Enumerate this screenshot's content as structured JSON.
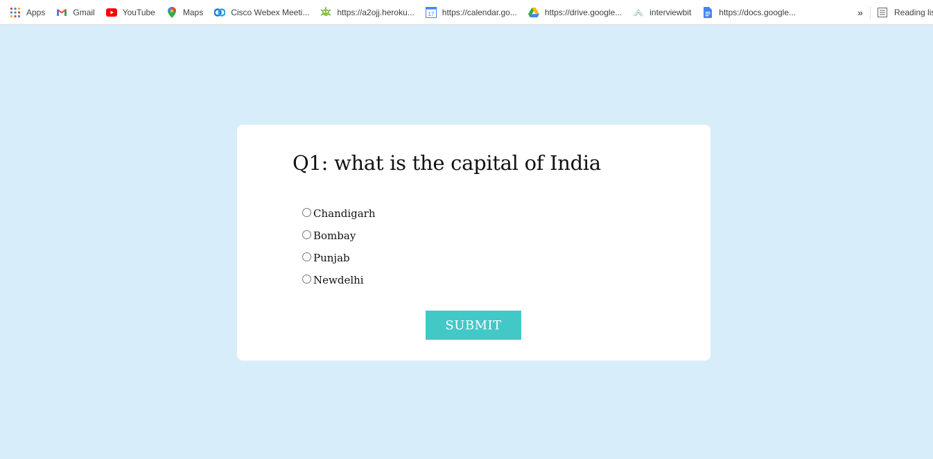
{
  "bookmarks": [
    {
      "label": "Apps",
      "icon": "apps-grid-icon"
    },
    {
      "label": "Gmail",
      "icon": "gmail-icon"
    },
    {
      "label": "YouTube",
      "icon": "youtube-icon"
    },
    {
      "label": "Maps",
      "icon": "maps-pin-icon"
    },
    {
      "label": "Cisco Webex Meeti...",
      "icon": "webex-icon"
    },
    {
      "label": "https://a2ojj.heroku...",
      "icon": "bug-icon"
    },
    {
      "label": "https://calendar.go...",
      "icon": "calendar-icon"
    },
    {
      "label": "https://drive.google...",
      "icon": "drive-icon"
    },
    {
      "label": "interviewbit",
      "icon": "interviewbit-icon"
    },
    {
      "label": "https://docs.google...",
      "icon": "docs-icon"
    }
  ],
  "overflow_chevron": "»",
  "reading_list": {
    "label": "Reading lis"
  },
  "quiz": {
    "question": "Q1: what is the capital of India",
    "options": [
      "Chandigarh",
      "Bombay",
      "Punjab",
      "Newdelhi"
    ],
    "submit_label": "SUBMIT"
  },
  "colors": {
    "page_background": "#d8edfa",
    "card_background": "#ffffff",
    "submit_button": "#43c8c8"
  }
}
